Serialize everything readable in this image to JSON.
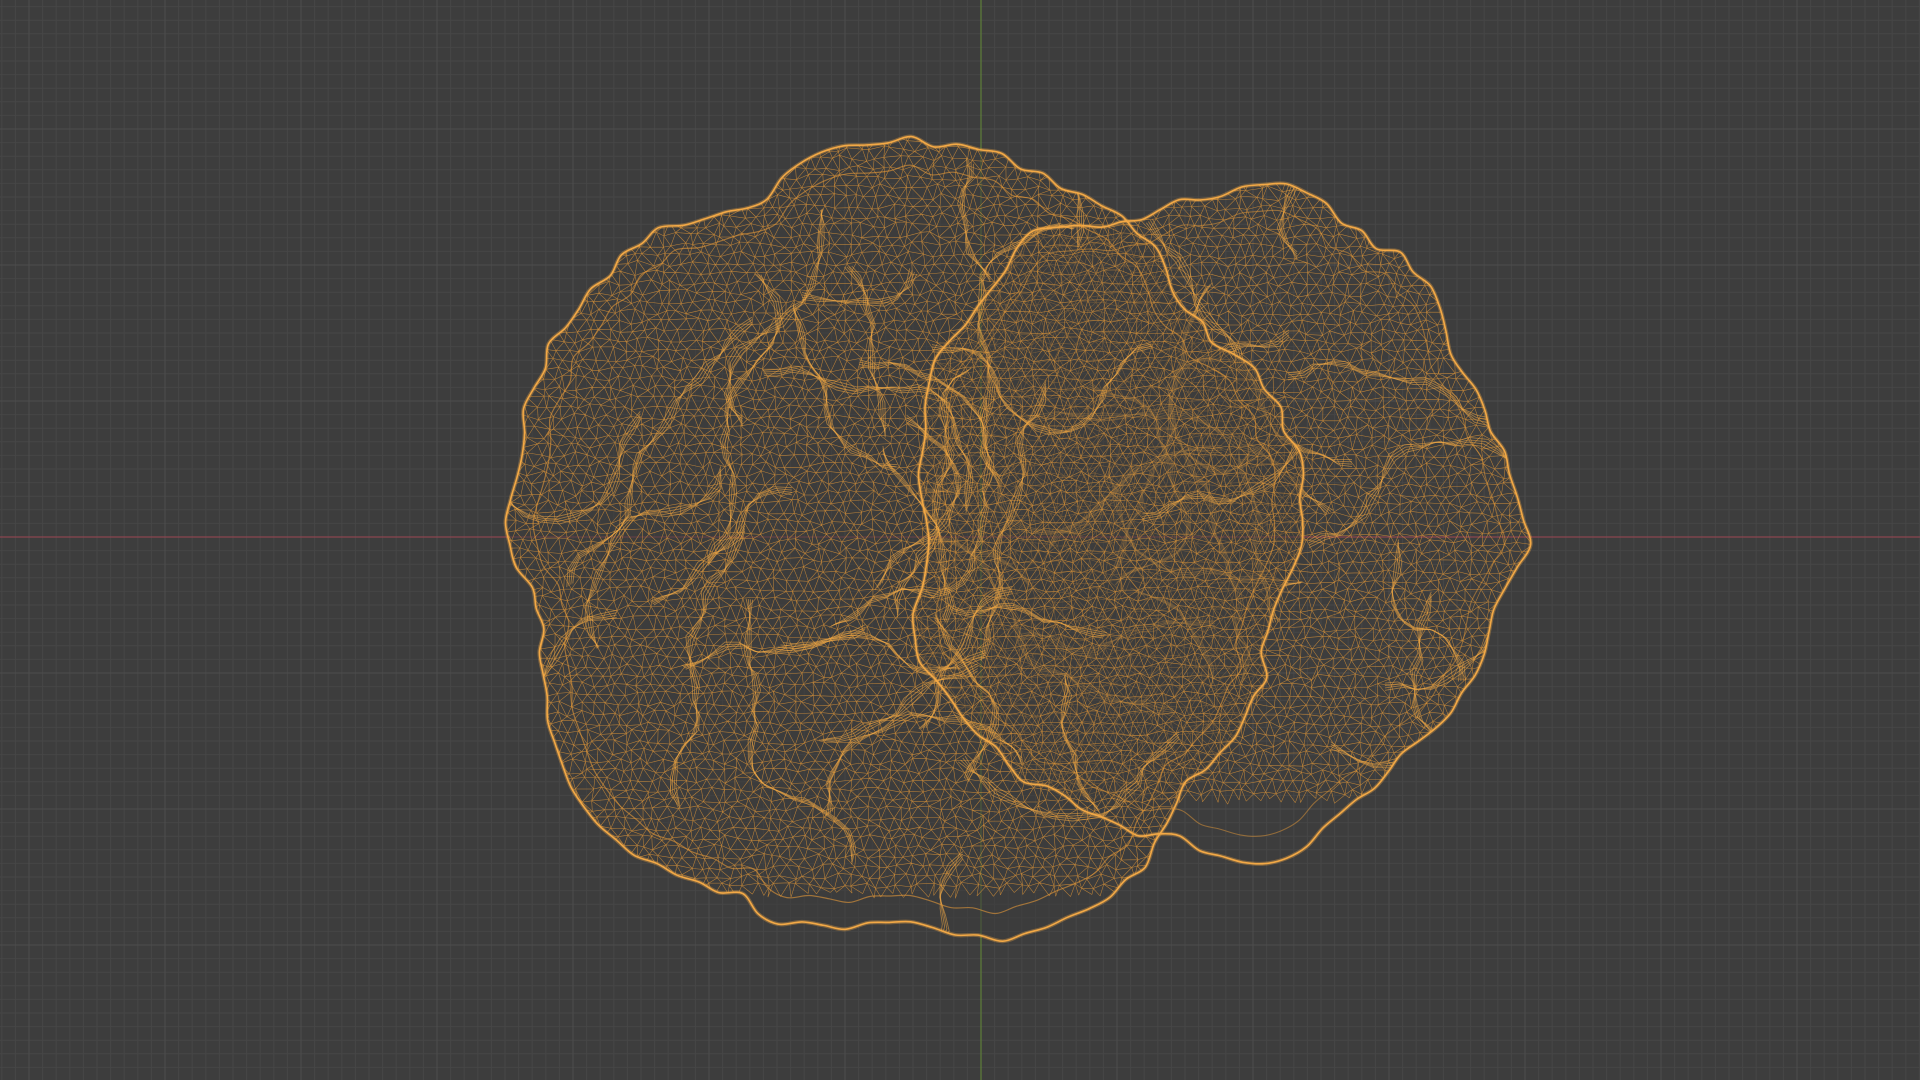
{
  "viewport": {
    "mode": "wireframe",
    "object": "sculpted-mesh",
    "colors": {
      "background": "#3d3d3d",
      "grid_minor": "#464646",
      "grid_major": "#4d4d4d",
      "x_axis": "#8a4650",
      "y_axis": "#5c7a3a",
      "wire": "#e69a38",
      "wire_bright": "#f3a946"
    }
  }
}
